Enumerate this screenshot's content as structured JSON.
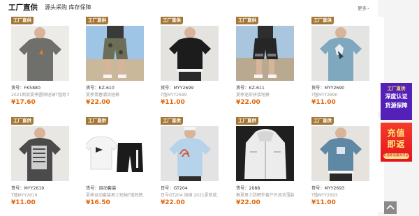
{
  "header": {
    "title": "工厂直供",
    "subtitle": "源头采购 库存保障",
    "more_label": "更多"
  },
  "badge_label": "工厂直供",
  "products": [
    {
      "code": "货号：FK5880",
      "desc": "2021新款夏季圆领短袖T恤男士…",
      "price": "¥17.60"
    },
    {
      "code": "货号：KZ-610",
      "desc": "夏季青春潮流短裤",
      "price": "¥22.00"
    },
    {
      "code": "货号：MYY2699",
      "desc": "T恤MYY2699",
      "price": "¥11.00"
    },
    {
      "code": "货号：KZ-611",
      "desc": "夏季迷彩拼接短裤",
      "price": "¥22.00"
    },
    {
      "code": "货号：MYY2690",
      "desc": "T恤MYY2690",
      "price": "¥11.00"
    },
    {
      "code": "货号：MYY2619",
      "desc": "T恤MYY2619",
      "price": "¥11.00"
    },
    {
      "code": "货号：运动套装",
      "desc": "夏季运动套装男士短袖T恤短裤…",
      "price": "¥16.50"
    },
    {
      "code": "日号：GT204",
      "desc": "日号GT204 纯棉 2021夏新款…",
      "price": "¥22.00"
    },
    {
      "code": "货号：2088",
      "desc": "春夏男士防晒外套户外风衣薄款…",
      "price": "¥22.00"
    },
    {
      "code": "货号：MYY2693",
      "desc": "T恤MYY2693",
      "price": "¥11.00"
    }
  ],
  "side_banner_1": {
    "top": "工厂直供",
    "line1": "深度认证",
    "line2": "货源保障"
  },
  "side_banner_2": {
    "line1": "充值",
    "line2": "即返",
    "tag": "充值即返最高可返12%"
  },
  "icons": {
    "more": "chevron-right-icon",
    "back_to_top": "arrow-up-icon"
  },
  "colors": {
    "badge": "#a47736",
    "price": "#e0650b",
    "side1": "#5320b8",
    "side2": "#e6141c"
  }
}
